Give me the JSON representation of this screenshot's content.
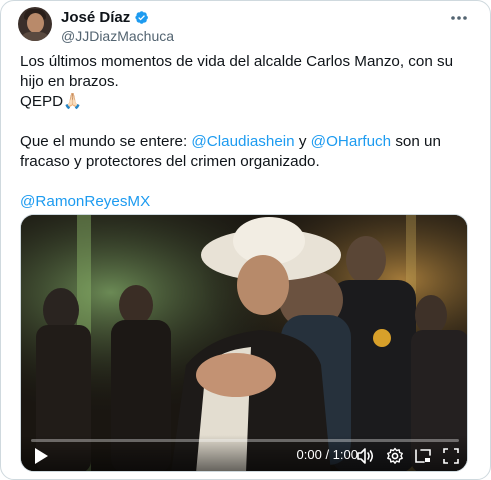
{
  "author": {
    "display_name": "José Díaz",
    "handle": "@JJDiazMachuca"
  },
  "tweet": {
    "line1": "Los últimos momentos de vida del alcalde Carlos Manzo, con su hijo en brazos.",
    "line2": "QEPD🙏🏻",
    "line3_prefix": "Que el mundo se entere: ",
    "mention1": "@Claudiashein",
    "line3_middle": " y ",
    "mention2": "@OHarfuch",
    "line3_suffix": " son un fracaso y protectores del crimen organizado.",
    "mention3": "@RamonReyesMX"
  },
  "video": {
    "time": "0:00 / 1:00",
    "progress": 0.0
  },
  "colors": {
    "link": "#1d9bf0",
    "verified": "#1d9bf0",
    "text": "#0f1419",
    "secondary": "#536471"
  },
  "icons": [
    "verified-badge-icon",
    "more-options-icon",
    "play-icon",
    "volume-icon",
    "settings-icon",
    "pip-icon",
    "fullscreen-icon"
  ]
}
